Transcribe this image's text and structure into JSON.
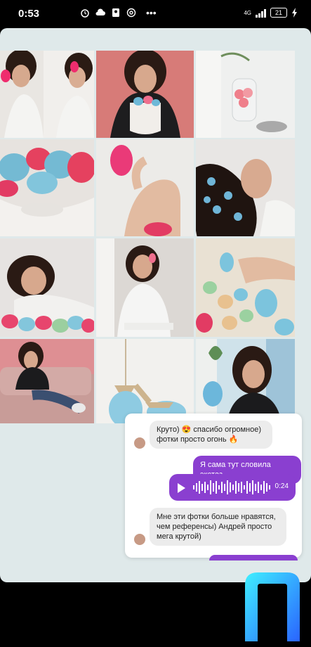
{
  "status_bar": {
    "time": "0:53",
    "network": "4G",
    "battery": "21"
  },
  "photos": [
    {
      "name": "photo-girl-white-shirt-sponge",
      "bg": "#e9e6e2",
      "accent": "#ef2d6e"
    },
    {
      "name": "photo-girl-holding-sponge-profile",
      "bg": "#eeeae6",
      "accent": "#ef2d6e"
    },
    {
      "name": "photo-girl-black-top-bowl",
      "bg": "#d77b78",
      "accent": "#6db8d7"
    },
    {
      "name": "photo-vase-and-jar",
      "bg": "#eff0ef",
      "accent": "#ef7f8b"
    },
    {
      "name": "photo-sponges-in-bowl",
      "bg": "#e7e3df",
      "accent": "#74bad3"
    },
    {
      "name": "photo-hand-pink-sponge",
      "bg": "#ecebe8",
      "accent": "#ea3a78"
    },
    {
      "name": "photo-girl-lying-sponges-hair",
      "bg": "#e8e6e4",
      "accent": "#6fb5d7"
    },
    {
      "name": "photo-girl-leaning-sponges",
      "bg": "#e6e3e1",
      "accent": "#e7456d"
    },
    {
      "name": "photo-girl-mirror-sponge",
      "bg": "#dcd8d4",
      "accent": "#ef6f8e"
    },
    {
      "name": "photo-hands-sponges-pile",
      "bg": "#e9e1d3",
      "accent": "#7cc4dd"
    },
    {
      "name": "photo-girl-pink-sofa",
      "bg": "#de8f93",
      "accent": "#e5b1ad"
    },
    {
      "name": "photo-hanging-sponges",
      "bg": "#f2f1ee",
      "accent": "#8ecbe2"
    },
    {
      "name": "photo-girl-blue-sponge-window",
      "bg": "#cfe2ea",
      "accent": "#6cb7db"
    }
  ],
  "chat": {
    "msg_in_1_line1": "Круто) 😍 спасибо огромное)",
    "msg_in_1_line2": "фотки просто огонь 🔥",
    "msg_out_1": "Я сама тут словила экстаз",
    "voice_duration": "0:24",
    "msg_in_2_line1": "Мне эти фотки больше нравятся,",
    "msg_in_2_line2": "чем референсы) Андрей просто",
    "msg_in_2_line3": "мега крутой)"
  },
  "colors": {
    "accent_purple": "#8a3fd0",
    "card_bg": "#dfe9ea",
    "logo_gradient_start": "#3ff0ff",
    "logo_gradient_end": "#2a64ff"
  }
}
